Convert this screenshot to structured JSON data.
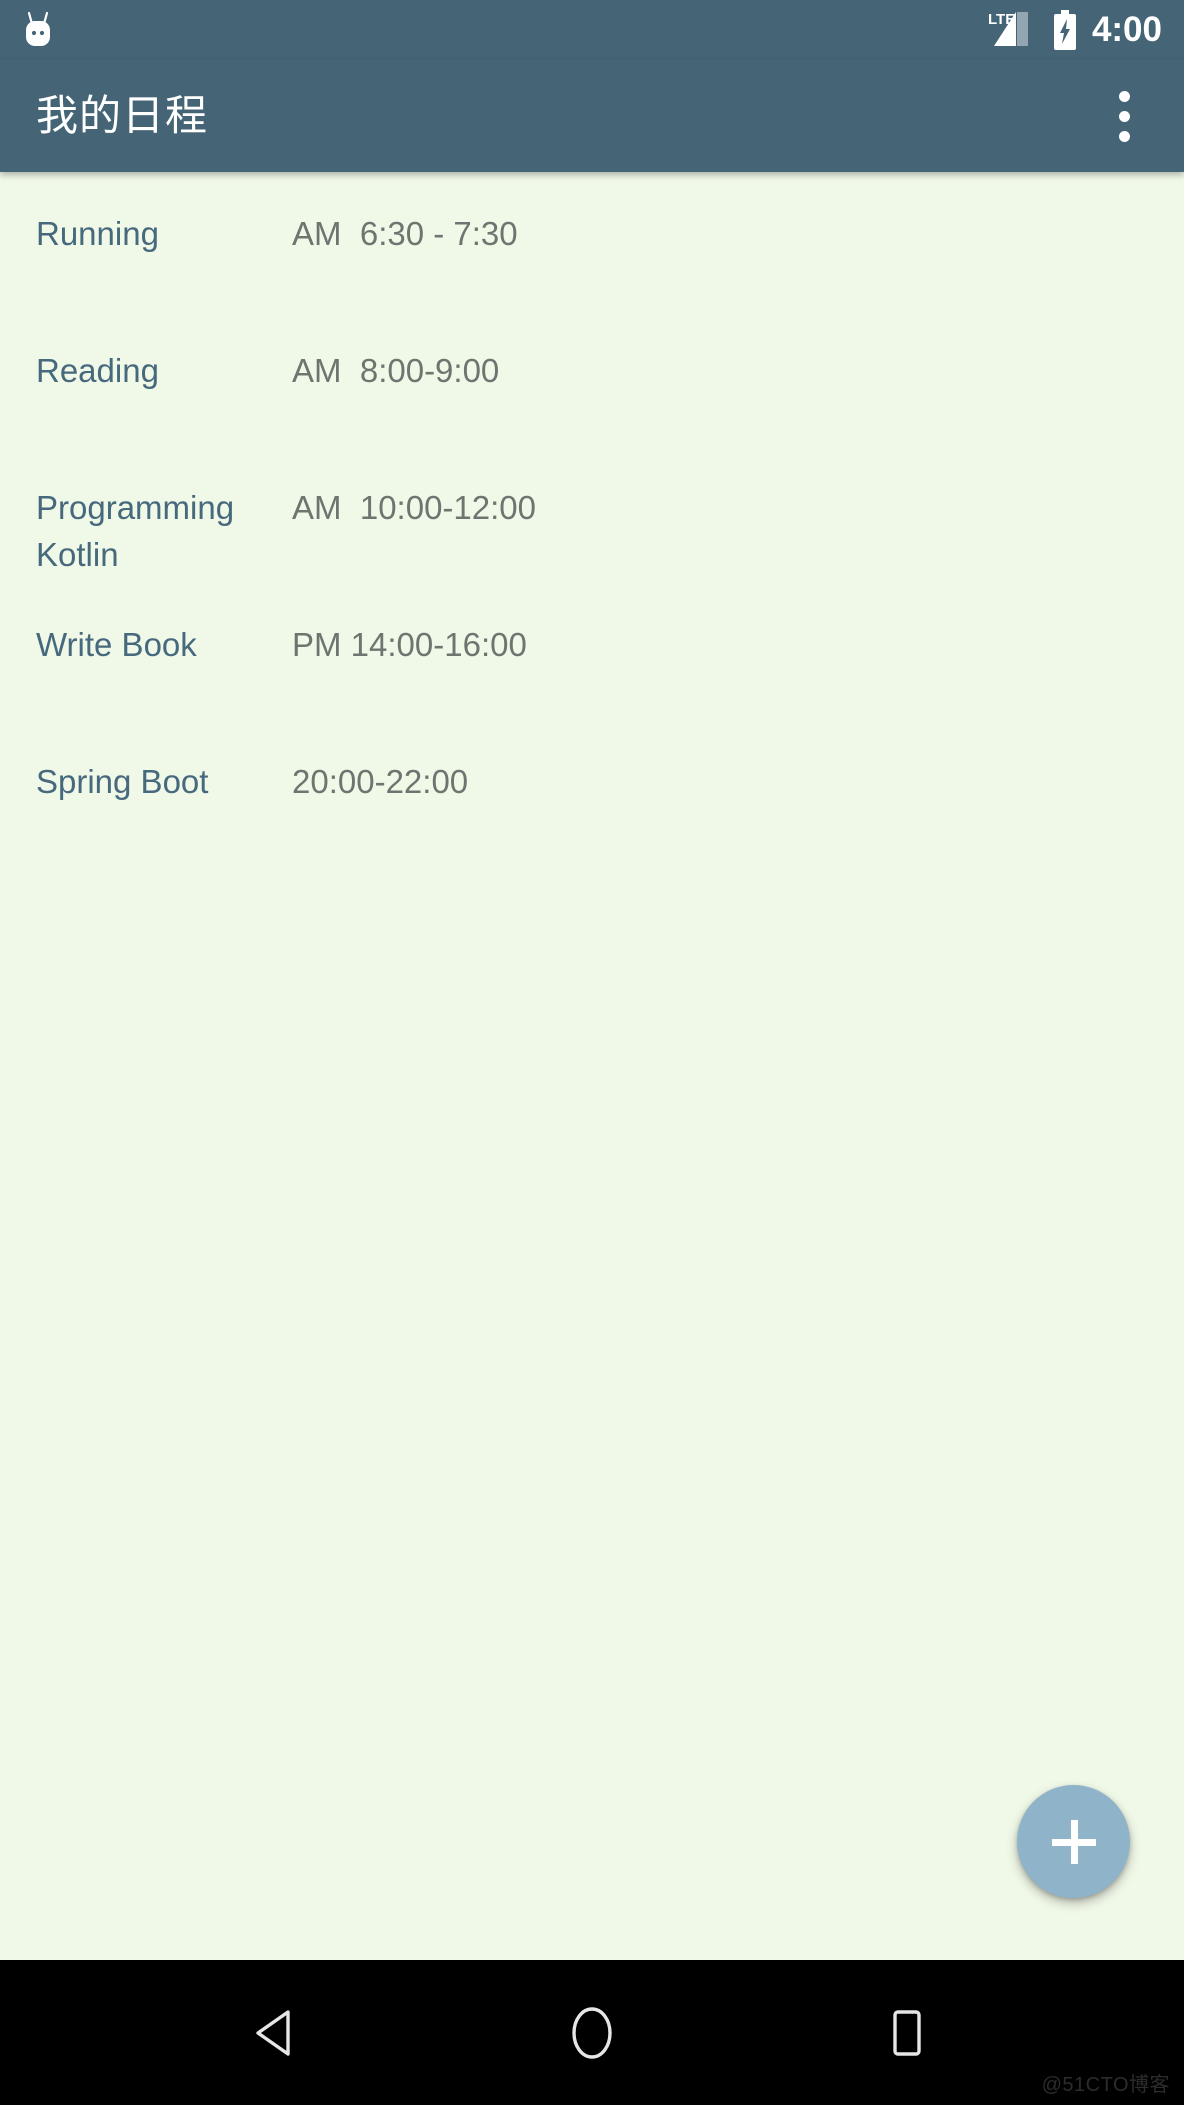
{
  "status_bar": {
    "android_icon": "android-marshmallow-icon",
    "network_label": "LTE",
    "signal_icon": "signal-bars-icon",
    "battery_icon": "battery-charging-icon",
    "clock": "4:00",
    "background_color": "#456577",
    "foreground_color": "#ffffff"
  },
  "app_bar": {
    "title": "我的日程",
    "overflow_icon": "more-vertical-icon",
    "background_color": "#456577",
    "title_color": "#ffffff"
  },
  "content": {
    "background_color": "#f0f8e8",
    "title_color": "#46697d",
    "time_color": "#6e7570",
    "schedule": [
      {
        "title": "Running",
        "time": "AM  6:30 - 7:30"
      },
      {
        "title": "Reading",
        "time": "AM  8:00-9:00"
      },
      {
        "title": "Programming Kotlin",
        "time": "AM  10:00-12:00"
      },
      {
        "title": "Write Book",
        "time": "PM 14:00-16:00"
      },
      {
        "title": "Spring Boot",
        "time": "20:00-22:00"
      }
    ]
  },
  "fab": {
    "icon": "plus-icon",
    "label": "+",
    "background_color": "#8fb3c8",
    "icon_color": "#ffffff"
  },
  "nav_bar": {
    "background_color": "#000000",
    "back_icon": "back-triangle-icon",
    "home_icon": "home-circle-icon",
    "recents_icon": "recents-square-icon"
  },
  "watermark": {
    "text": "@51CTO博客"
  }
}
